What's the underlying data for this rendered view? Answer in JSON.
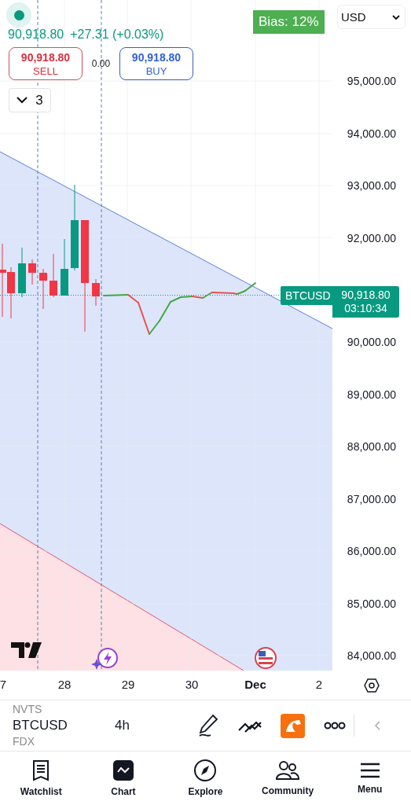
{
  "header": {
    "price": "90,918.80",
    "change": "+27.31 (+0.03%)",
    "sell": {
      "price": "90,918.80",
      "label": "SELL"
    },
    "spread": "0.00",
    "buy": {
      "price": "90,918.80",
      "label": "BUY"
    },
    "collapse_count": "3",
    "bias": "Bias: 12%",
    "currency": "USD"
  },
  "price_axis": {
    "upper": [
      "95,000.00",
      "94,000.00",
      "93,000.00",
      "92,000.00"
    ],
    "lower": [
      "90,000.00",
      "89,000.00",
      "88,000.00",
      "87,000.00",
      "86,000.00",
      "85,000.00",
      "84,000.00"
    ]
  },
  "last_price": {
    "symbol": "BTCUSD",
    "price": "90,918.80",
    "countdown": "03:10:34"
  },
  "time_axis": [
    {
      "text": "7",
      "kind": "day"
    },
    {
      "text": "28",
      "kind": "day"
    },
    {
      "text": "29",
      "kind": "day"
    },
    {
      "text": "30",
      "kind": "day"
    },
    {
      "text": "Dec",
      "kind": "month"
    },
    {
      "text": "2",
      "kind": "day"
    }
  ],
  "toolbar": {
    "prev_symbol": "NVTS",
    "symbol": "BTCUSD",
    "interval": "4h",
    "next_symbol": "FDX"
  },
  "nav": [
    {
      "label": "Watchlist",
      "selected": false
    },
    {
      "label": "Chart",
      "selected": true
    },
    {
      "label": "Explore",
      "selected": false
    },
    {
      "label": "Community",
      "selected": false
    },
    {
      "label": "Menu",
      "selected": false
    }
  ]
}
